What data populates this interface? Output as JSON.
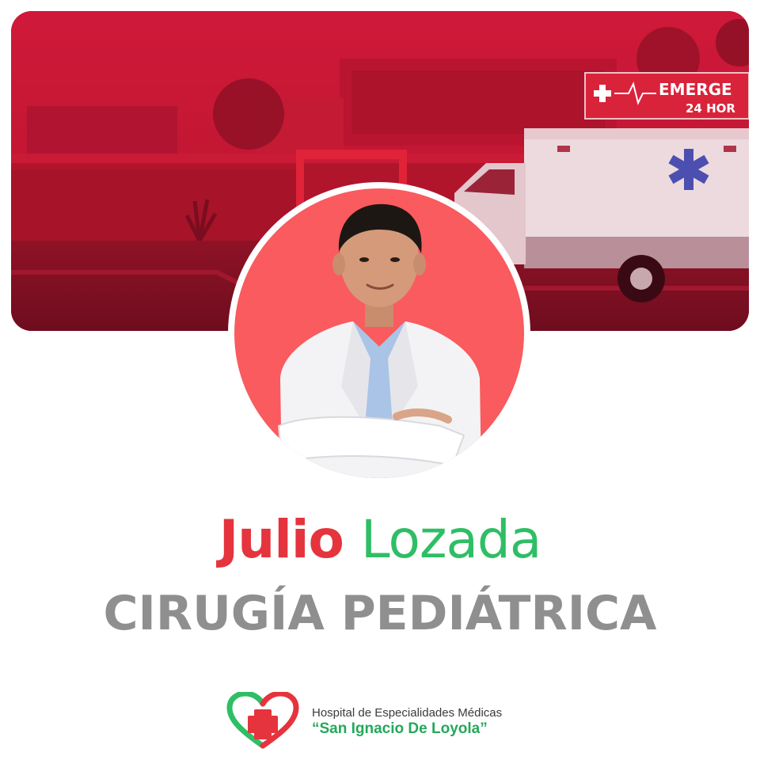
{
  "banner": {
    "tint_color": "#c8182f",
    "emergency_sign": {
      "line1": "EMERGE",
      "line2": "24 HOR"
    }
  },
  "avatar": {
    "background": "#f95b5e"
  },
  "doctor": {
    "first_name": "Julio",
    "last_name": "Lozada",
    "first_color": "#e5343d",
    "last_color": "#2fbe65"
  },
  "specialty": "CIRUGÍA PEDIÁTRICA",
  "hospital": {
    "line1": "Hospital de Especialidades Médicas",
    "line2": "“San Ignacio De Loyola”",
    "logo_icon": "heart-cross-icon"
  }
}
